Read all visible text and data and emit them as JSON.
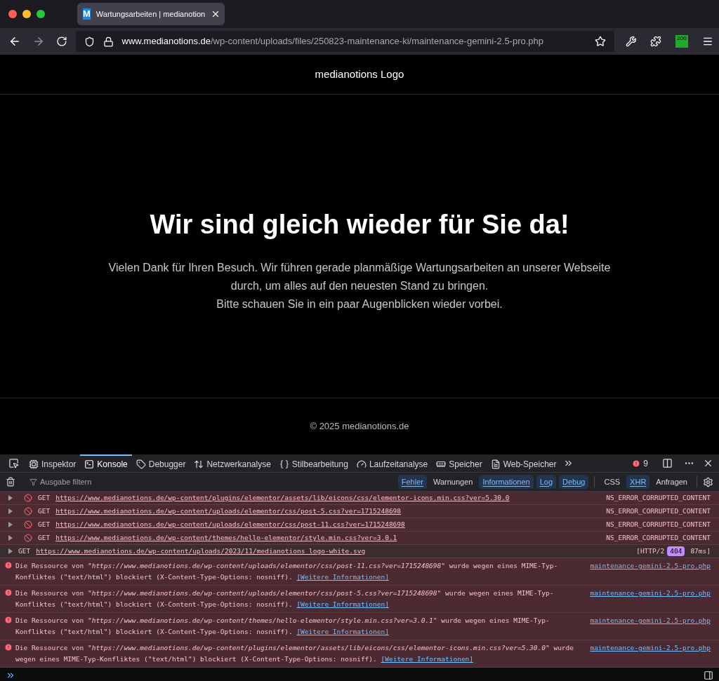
{
  "browser": {
    "tab": {
      "title": "Wartungsarbeiten | medianotion",
      "favicon": "M",
      "selected": true
    },
    "url": {
      "host": "www.medianotions.de",
      "path": "/wp-content/uploads/files/250823-maintenance-ki/maintenance-gemini-2.5-pro.php"
    },
    "extension_badge": "200"
  },
  "page": {
    "logo": "medianotions Logo",
    "heading": "Wir sind gleich wieder für Sie da!",
    "paragraphs": [
      "Vielen Dank für Ihren Besuch. Wir führen gerade planmäßige Wartungsarbeiten an unserer Webseite durch, um alles auf den neuesten Stand zu bringen.",
      "Bitte schauen Sie in ein paar Augenblicken wieder vorbei."
    ],
    "footer": "© 2025 medianotions.de"
  },
  "devtools": {
    "tabs": [
      {
        "label": "Inspektor",
        "kind": "inspector",
        "selected": false
      },
      {
        "label": "Konsole",
        "kind": "console",
        "selected": true
      },
      {
        "label": "Debugger",
        "kind": "debugger",
        "selected": false
      },
      {
        "label": "Netzwerkanalyse",
        "kind": "network",
        "selected": false
      },
      {
        "label": "Stilbearbeitung",
        "kind": "style",
        "selected": false
      },
      {
        "label": "Laufzeitanalyse",
        "kind": "performance",
        "selected": false
      },
      {
        "label": "Speicher",
        "kind": "memory",
        "selected": false
      },
      {
        "label": "Web-Speicher",
        "kind": "storage",
        "selected": false
      }
    ],
    "error_count": "9",
    "filter_placeholder": "Ausgabe filtern",
    "levels": [
      {
        "label": "Fehler",
        "selected": true
      },
      {
        "label": "Warnungen",
        "selected": false
      },
      {
        "label": "Informationen",
        "selected": true
      },
      {
        "label": "Log",
        "selected": true
      },
      {
        "label": "Debug",
        "selected": true
      }
    ],
    "categories": [
      {
        "label": "CSS",
        "selected": false
      },
      {
        "label": "XHR",
        "selected": true
      },
      {
        "label": "Anfragen",
        "selected": false
      }
    ],
    "entries": [
      {
        "kind": "network-error",
        "method": "GET",
        "url": "https://www.medianotions.de/wp-content/plugins/elementor/assets/lib/eicons/css/elementor-icons.min.css?ver=5.30.0",
        "status": "NS_ERROR_CORRUPTED_CONTENT"
      },
      {
        "kind": "network-error",
        "method": "GET",
        "url": "https://www.medianotions.de/wp-content/uploads/elementor/css/post-5.css?ver=1715248698",
        "status": "NS_ERROR_CORRUPTED_CONTENT"
      },
      {
        "kind": "network-error",
        "method": "GET",
        "url": "https://www.medianotions.de/wp-content/uploads/elementor/css/post-11.css?ver=1715248698",
        "status": "NS_ERROR_CORRUPTED_CONTENT"
      },
      {
        "kind": "network-error",
        "method": "GET",
        "url": "https://www.medianotions.de/wp-content/themes/hello-elementor/style.min.css?ver=3.0.1",
        "status": "NS_ERROR_CORRUPTED_CONTENT"
      },
      {
        "kind": "network",
        "method": "GET",
        "url": "https://www.medianotions.de/wp-content/uploads/2023/11/medianotions_logo-white.svg",
        "protocol": "[HTTP/2",
        "code": "404",
        "time": "87ms]"
      },
      {
        "kind": "error",
        "text": "Die Ressource von \"*https://www.medianotions.de/wp-content/uploads/elementor/css/post-11.css?ver=1715248698*\" wurde wegen eines MIME-Typ-Konfliktes (\"text/html\") blockiert (X-Content-Type-Options: nosniff).",
        "link": "[Weitere Informationen]",
        "source": "maintenance-gemini-2.5-pro.php"
      },
      {
        "kind": "error",
        "text": "Die Ressource von \"*https://www.medianotions.de/wp-content/uploads/elementor/css/post-5.css?ver=1715248698*\" wurde wegen eines MIME-Typ-Konfliktes (\"text/html\") blockiert (X-Content-Type-Options: nosniff).",
        "link": "[Weitere Informationen]",
        "source": "maintenance-gemini-2.5-pro.php"
      },
      {
        "kind": "error",
        "text": "Die Ressource von \"*https://www.medianotions.de/wp-content/themes/hello-elementor/style.min.css?ver=3.0.1*\" wurde wegen eines MIME-Typ-Konfliktes (\"text/html\") blockiert (X-Content-Type-Options: nosniff).",
        "link": "[Weitere Informationen]",
        "source": "maintenance-gemini-2.5-pro.php"
      },
      {
        "kind": "error",
        "text": "Die Ressource von \"*https://www.medianotions.de/wp-content/plugins/elementor/assets/lib/eicons/css/elementor-icons.min.css?ver=5.30.0*\" wurde wegen eines MIME-Typ-Konfliktes (\"text/html\") blockiert (X-Content-Type-Options: nosniff).",
        "link": "[Weitere Informationen]",
        "source": "maintenance-gemini-2.5-pro.php"
      }
    ]
  }
}
